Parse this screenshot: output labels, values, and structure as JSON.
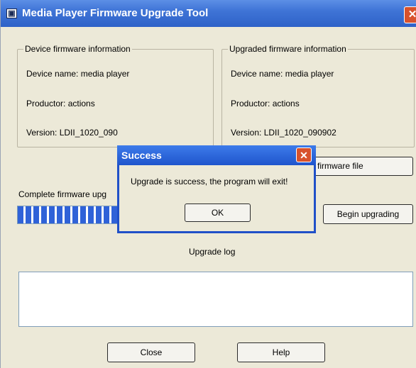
{
  "window": {
    "title": "Media Player Firmware Upgrade Tool",
    "close_glyph": "✕",
    "icon": "app-icon"
  },
  "device_info": {
    "legend": "Device firmware information",
    "name": "Device name: media player",
    "productor": "Productor: actions",
    "version": "Version: LDII_1020_090"
  },
  "upgraded_info": {
    "legend": "Upgraded firmware information",
    "name": "Device name: media player",
    "productor": "Productor: actions",
    "version": "Version: LDII_1020_090902"
  },
  "buttons": {
    "select_firmware": "firmware file",
    "begin_upgrading": "Begin upgrading",
    "close": "Close",
    "help": "Help"
  },
  "progress": {
    "label": "Complete firmware upg",
    "percent": 100
  },
  "log": {
    "label": "Upgrade log"
  },
  "dialog": {
    "title": "Success",
    "message": "Upgrade is success, the program will exit!",
    "ok_label": "OK",
    "close_glyph": "✕"
  },
  "colors": {
    "titlebar": "#3f74d6",
    "progress": "#2f62d8",
    "close_button": "#d8522c"
  }
}
